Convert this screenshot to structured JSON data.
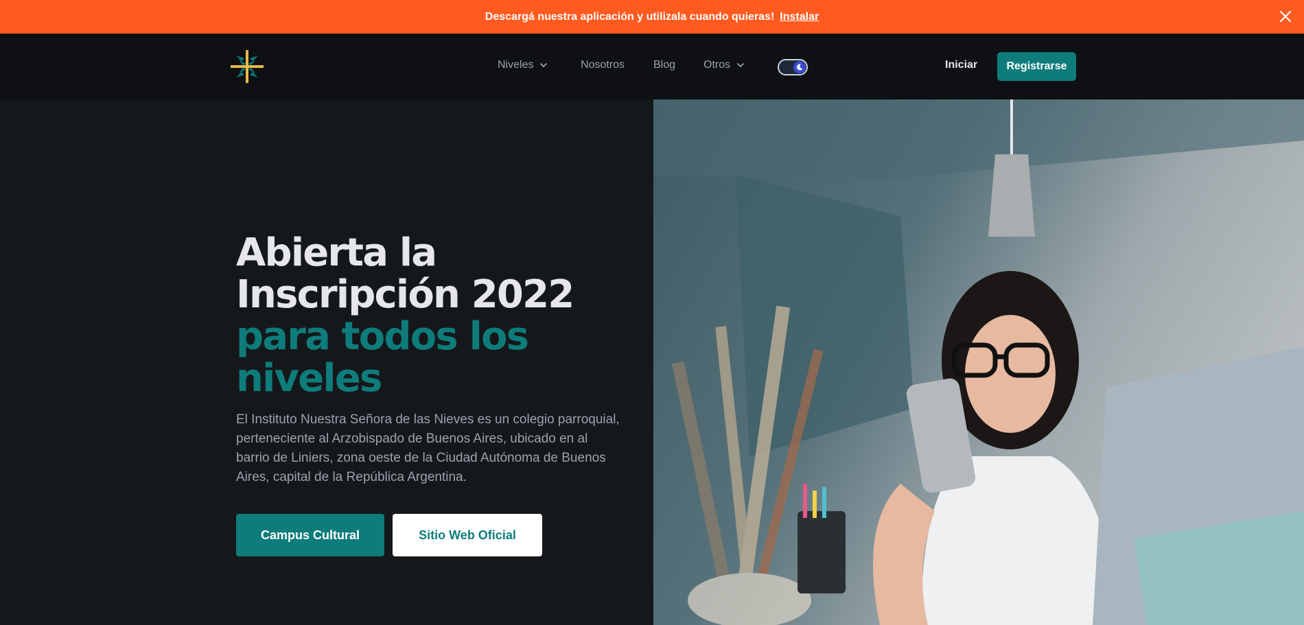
{
  "banner": {
    "message": "Descargá nuestra aplicación y utilizala cuando quieras!",
    "link": "Instalar",
    "close_icon": "close-icon",
    "bg_color": "#ff5a1f"
  },
  "nav": {
    "logo_icon": "cross-logo-icon",
    "links": [
      {
        "label": "Niveles",
        "has_dropdown": true
      },
      {
        "label": "Nosotros",
        "has_dropdown": false
      },
      {
        "label": "Blog",
        "has_dropdown": false
      },
      {
        "label": "Otros",
        "has_dropdown": true
      }
    ],
    "theme_toggle_icon": "moon-icon",
    "login": "Iniciar",
    "register": "Registrarse",
    "accent_color": "#0e7c7b"
  },
  "hero": {
    "headline_1": "Abierta la Inscripción 2022",
    "headline_2": "para todos los niveles",
    "description": "El Instituto Nuestra Señora de las Nieves es un colegio parroquial, perteneciente al Arzobispado de Buenos Aires, ubicado en al barrio de Liniers, zona oeste de la Ciudad Autónoma de Buenos Aires, capital de la República Argentina.",
    "primary_button": "Campus Cultural",
    "secondary_button": "Sitio Web Oficial",
    "image": "woman-with-phone-photo"
  }
}
